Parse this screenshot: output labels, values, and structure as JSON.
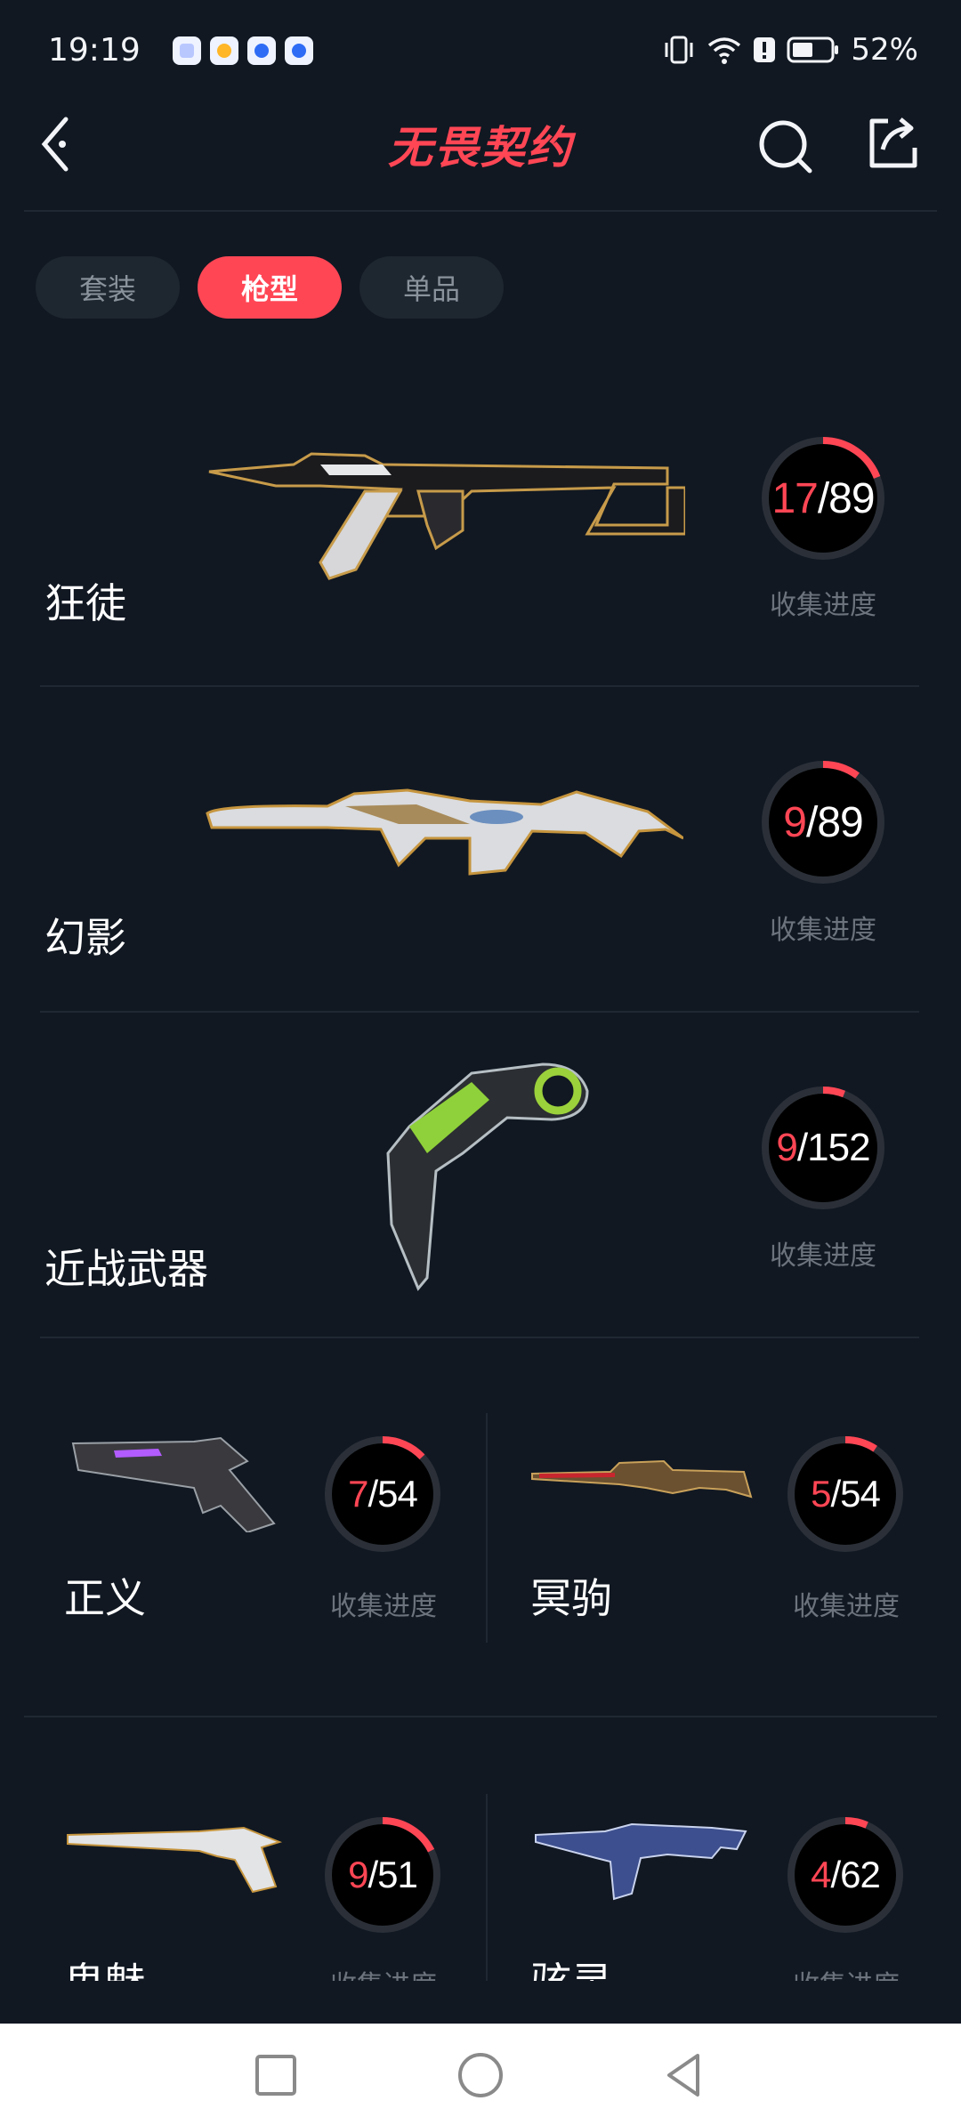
{
  "status_bar": {
    "time": "19:19",
    "app_icons": [
      "app-icon-1",
      "weather-icon",
      "browser-icon",
      "browser-icon"
    ],
    "battery_text": "52%"
  },
  "header": {
    "title": "无畏契约",
    "back_icon": "chevron-left-icon",
    "search_icon": "search-icon",
    "share_icon": "share-icon"
  },
  "tabs": [
    {
      "label": "套装",
      "active": false
    },
    {
      "label": "枪型",
      "active": true
    },
    {
      "label": "单品",
      "active": false
    }
  ],
  "progress_label": "收集进度",
  "weapons_large": [
    {
      "name": "狂徒",
      "collected": "17",
      "total": "89",
      "progress": 0.191
    },
    {
      "name": "幻影",
      "collected": "9",
      "total": "89",
      "progress": 0.101
    },
    {
      "name": "近战武器",
      "collected": "9",
      "total": "152",
      "progress": 0.059
    }
  ],
  "weapons_small": [
    {
      "name": "正义",
      "collected": "7",
      "total": "54",
      "progress": 0.13
    },
    {
      "name": "冥驹",
      "collected": "5",
      "total": "54",
      "progress": 0.093
    },
    {
      "name": "鬼魅",
      "collected": "9",
      "total": "51",
      "progress": 0.176
    },
    {
      "name": "骇灵",
      "collected": "4",
      "total": "62",
      "progress": 0.065
    }
  ],
  "colors": {
    "accent": "#ff4655",
    "background": "#111822",
    "ring_track": "#2b3038"
  }
}
